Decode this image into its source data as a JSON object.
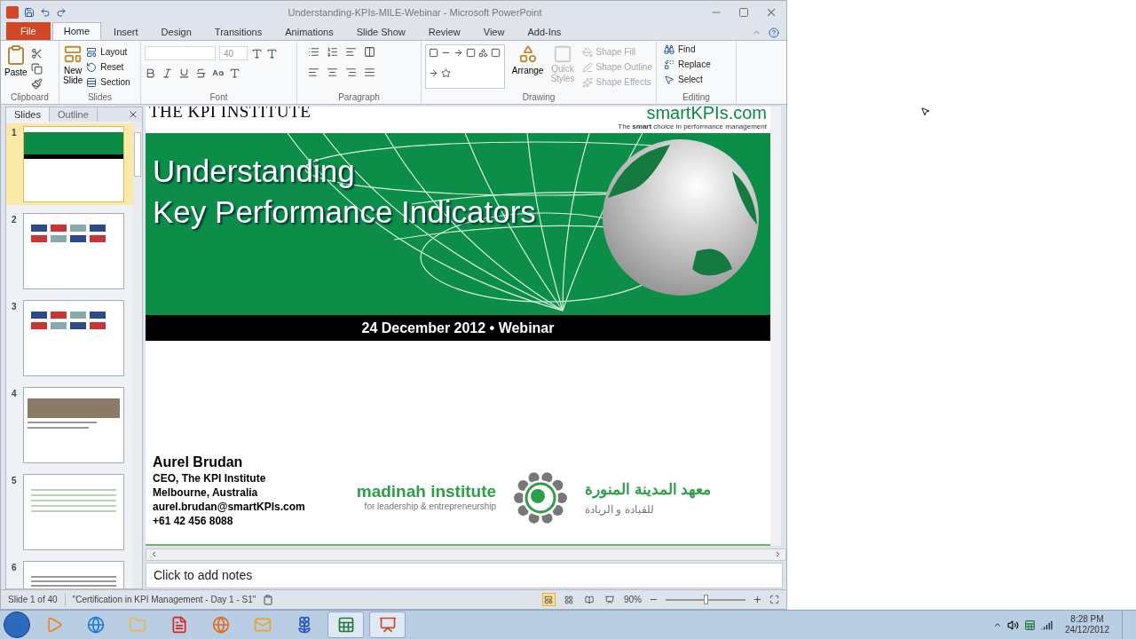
{
  "window": {
    "title": "Understanding-KPIs-MILE-Webinar - Microsoft PowerPoint"
  },
  "ribbon_tabs": [
    {
      "label": "File",
      "kind": "file",
      "selected": false
    },
    {
      "label": "Home",
      "kind": "tab",
      "selected": true
    },
    {
      "label": "Insert",
      "kind": "tab",
      "selected": false
    },
    {
      "label": "Design",
      "kind": "tab",
      "selected": false
    },
    {
      "label": "Transitions",
      "kind": "tab",
      "selected": false
    },
    {
      "label": "Animations",
      "kind": "tab",
      "selected": false
    },
    {
      "label": "Slide Show",
      "kind": "tab",
      "selected": false
    },
    {
      "label": "Review",
      "kind": "tab",
      "selected": false
    },
    {
      "label": "View",
      "kind": "tab",
      "selected": false
    },
    {
      "label": "Add-Ins",
      "kind": "tab",
      "selected": false
    }
  ],
  "ribbon": {
    "clipboard": {
      "label": "Clipboard",
      "paste": "Paste"
    },
    "slides": {
      "label": "Slides",
      "new_slide": [
        "New",
        "Slide"
      ],
      "items": [
        {
          "label": "Layout",
          "kind": "layout"
        },
        {
          "label": "Reset",
          "kind": "reset"
        },
        {
          "label": "Section",
          "kind": "section"
        }
      ]
    },
    "font": {
      "label": "Font",
      "size": "40"
    },
    "paragraph": {
      "label": "Paragraph"
    },
    "drawing": {
      "label": "Drawing",
      "arrange": "Arrange",
      "quick_styles": [
        "Quick",
        "Styles"
      ],
      "quick_styles_disabled": true,
      "shape_items": [
        {
          "label": "Shape Fill",
          "kind": "fill",
          "disabled": true
        },
        {
          "label": "Shape Outline",
          "kind": "outline",
          "disabled": true
        },
        {
          "label": "Shape Effects",
          "kind": "effects",
          "disabled": true
        }
      ]
    },
    "editing": {
      "label": "Editing",
      "items": [
        {
          "label": "Find",
          "kind": "find"
        },
        {
          "label": "Replace",
          "kind": "replace"
        },
        {
          "label": "Select",
          "kind": "select"
        }
      ]
    }
  },
  "slide_panel": {
    "tabs": [
      {
        "label": "Slides",
        "selected": true
      },
      {
        "label": "Outline",
        "selected": false
      }
    ],
    "thumbnails": [
      {
        "number": "1",
        "kind": "title",
        "selected": true
      },
      {
        "number": "2",
        "kind": "logos",
        "selected": false
      },
      {
        "number": "3",
        "kind": "logos",
        "selected": false
      },
      {
        "number": "4",
        "kind": "photos",
        "selected": false
      },
      {
        "number": "5",
        "kind": "table",
        "selected": false
      },
      {
        "number": "6",
        "kind": "text",
        "selected": false
      }
    ]
  },
  "slide": {
    "brand": "THE KPI INSTITUTE",
    "site_logo": "smartKPIs.com",
    "tagline": "The **smart** choice in performance management",
    "title_lines": [
      "Understanding",
      "Key Performance Indicators"
    ],
    "date_line": "24 December 2012 • Webinar",
    "presenter": {
      "name": "Aurel Brudan",
      "lines": [
        "CEO, The KPI Institute",
        "Melbourne, Australia",
        "aurel.brudan@smartKPIs.com",
        "+61 42 456 8088"
      ]
    },
    "partner": {
      "name": "madinah institute",
      "subtitle": "for leadership & entrepreneurship",
      "arabic_name": "معهد المدينة المنورة",
      "arabic_subtitle": "للقيادة و الريادة"
    }
  },
  "notes": {
    "placeholder": "Click to add notes"
  },
  "status_bar": {
    "slide_info": "Slide 1 of 40",
    "theme": "\"Certification in KPI Management - Day 1 - S1\"",
    "views": [
      {
        "kind": "normal",
        "selected": true
      },
      {
        "kind": "sorter",
        "selected": false
      },
      {
        "kind": "reading",
        "selected": false
      },
      {
        "kind": "slideshow",
        "selected": false
      }
    ],
    "zoom": "90%",
    "zoom_slider": {
      "level": 0.5
    }
  },
  "taskbar": {
    "apps": [
      {
        "kind": "media",
        "selected": false
      },
      {
        "kind": "browser",
        "selected": false
      },
      {
        "kind": "folder",
        "selected": false
      },
      {
        "kind": "pdf",
        "selected": false
      },
      {
        "kind": "fox",
        "selected": false
      },
      {
        "kind": "mail",
        "selected": false
      },
      {
        "kind": "flower",
        "selected": false
      },
      {
        "kind": "sheet",
        "selected": true
      },
      {
        "kind": "slides",
        "selected": true
      }
    ],
    "time": "8:28 PM",
    "date": "24/12/2012"
  }
}
